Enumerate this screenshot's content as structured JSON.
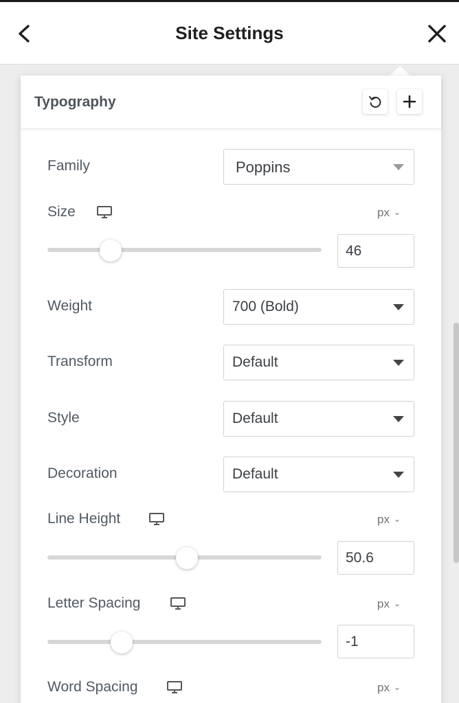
{
  "header": {
    "title": "Site Settings",
    "back_icon": "chevron-left-icon",
    "close_icon": "close-icon"
  },
  "panel": {
    "title": "Typography",
    "reset_icon": "reset-icon",
    "add_icon": "plus-icon"
  },
  "fields": {
    "family": {
      "label": "Family",
      "value": "Poppins"
    },
    "size": {
      "label": "Size",
      "unit": "px",
      "value": "46",
      "slider_fraction": 0.23
    },
    "weight": {
      "label": "Weight",
      "value": "700 (Bold)"
    },
    "transform": {
      "label": "Transform",
      "value": "Default"
    },
    "style": {
      "label": "Style",
      "value": "Default"
    },
    "decoration": {
      "label": "Decoration",
      "value": "Default"
    },
    "line_height": {
      "label": "Line Height",
      "unit": "px",
      "value": "50.6",
      "slider_fraction": 0.51
    },
    "letter_spacing": {
      "label": "Letter Spacing",
      "unit": "px",
      "value": "-1",
      "slider_fraction": 0.27
    },
    "word_spacing": {
      "label": "Word Spacing",
      "unit": "px"
    }
  },
  "colors": {
    "accent_dark": "#1f1f1f",
    "label": "#515962",
    "track": "#d7d7d7"
  }
}
